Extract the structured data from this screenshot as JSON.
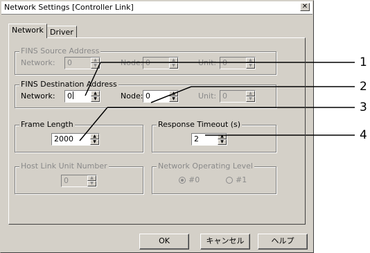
{
  "window": {
    "title": "Network Settings [Controller Link]",
    "close_glyph": "✕"
  },
  "tabs": [
    {
      "label": "Network",
      "active": true
    },
    {
      "label": "Driver",
      "active": false
    }
  ],
  "fins_source": {
    "legend": "FINS Source Address",
    "network_label": "Network:",
    "network_value": "0",
    "node_label": "Node:",
    "node_value": "0",
    "unit_label": "Unit:",
    "unit_value": "0"
  },
  "fins_destination": {
    "legend": "FINS Destination Address",
    "network_label": "Network:",
    "network_value": "0",
    "node_label": "Node:",
    "node_value": "0",
    "unit_label": "Unit:",
    "unit_value": "0"
  },
  "frame_length": {
    "legend": "Frame Length",
    "value": "2000"
  },
  "response_timeout": {
    "legend": "Response Timeout (s)",
    "value": "2"
  },
  "host_link": {
    "legend": "Host Link Unit Number",
    "value": "0"
  },
  "operating_level": {
    "legend": "Network Operating Level",
    "option0": "#0",
    "option1": "#1",
    "selected": "#0"
  },
  "buttons": {
    "ok": "OK",
    "cancel": "キャンセル",
    "help": "ヘルプ"
  },
  "callouts": [
    "1",
    "2",
    "3",
    "4"
  ]
}
